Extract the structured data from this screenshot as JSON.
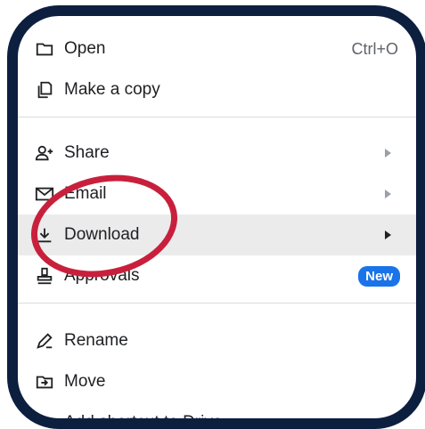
{
  "menu": {
    "open": {
      "label": "Open",
      "shortcut": "Ctrl+O",
      "icon": "folder-icon"
    },
    "make_copy": {
      "label": "Make a copy",
      "icon": "copy-icon"
    },
    "share": {
      "label": "Share",
      "icon": "person-add-icon"
    },
    "email": {
      "label": "Email",
      "icon": "mail-icon"
    },
    "download": {
      "label": "Download",
      "icon": "download-icon"
    },
    "approvals": {
      "label": "Approvals",
      "badge": "New",
      "icon": "approval-stamp-icon"
    },
    "rename": {
      "label": "Rename",
      "icon": "pencil-icon"
    },
    "move": {
      "label": "Move",
      "icon": "folder-move-icon"
    },
    "add_shortcut": {
      "label": "Add shortcut to Drive",
      "icon": "drive-shortcut-icon"
    }
  },
  "colors": {
    "frame": "#0d1f3f",
    "highlight_circle": "#c8203c",
    "badge": "#1a73e8",
    "hover_row": "#ebebeb"
  }
}
